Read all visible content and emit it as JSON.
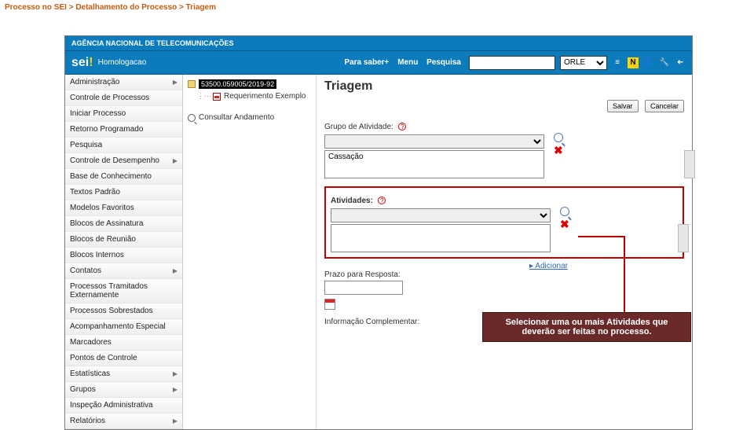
{
  "breadcrumb": "Processo no SEI > Detalhamento do Processo > Triagem",
  "banner": "AGÊNCIA NACIONAL DE TELECOMUNICAÇÕES",
  "logo": {
    "text": "sei",
    "accent": "!"
  },
  "env": "Homologacao",
  "header": {
    "parasaber": "Para saber+",
    "menu": "Menu",
    "pesquisa": "Pesquisa",
    "unit_selected": "ORLE",
    "icon_n": "N"
  },
  "sidebar": {
    "items": [
      {
        "label": "Administração",
        "arrow": true
      },
      {
        "label": "Controle de Processos",
        "arrow": false
      },
      {
        "label": "Iniciar Processo",
        "arrow": false
      },
      {
        "label": "Retorno Programado",
        "arrow": false
      },
      {
        "label": "Pesquisa",
        "arrow": false
      },
      {
        "label": "Controle de Desempenho",
        "arrow": true
      },
      {
        "label": "Base de Conhecimento",
        "arrow": false
      },
      {
        "label": "Textos Padrão",
        "arrow": false
      },
      {
        "label": "Modelos Favoritos",
        "arrow": false
      },
      {
        "label": "Blocos de Assinatura",
        "arrow": false
      },
      {
        "label": "Blocos de Reunião",
        "arrow": false
      },
      {
        "label": "Blocos Internos",
        "arrow": false
      },
      {
        "label": "Contatos",
        "arrow": true
      },
      {
        "label": "Processos Tramitados Externamente",
        "arrow": false
      },
      {
        "label": "Processos Sobrestados",
        "arrow": false
      },
      {
        "label": "Acompanhamento Especial",
        "arrow": false
      },
      {
        "label": "Marcadores",
        "arrow": false
      },
      {
        "label": "Pontos de Controle",
        "arrow": false
      },
      {
        "label": "Estatísticas",
        "arrow": true
      },
      {
        "label": "Grupos",
        "arrow": true
      },
      {
        "label": "Inspeção Administrativa",
        "arrow": false
      },
      {
        "label": "Relatórios",
        "arrow": true
      }
    ]
  },
  "tree": {
    "proc_number": "53500.059005/2019-92",
    "doc1": "Requerimento Exemplo",
    "consultar": "Consultar Andamento"
  },
  "main": {
    "title": "Triagem",
    "btn_salvar": "Salvar",
    "btn_cancelar": "Cancelar",
    "grupo_label": "Grupo de Atividade:",
    "grupo_value": "Cassação",
    "ativ_label": "Atividades:",
    "adicionar": "Adicionar",
    "prazo_label": "Prazo para Resposta:",
    "info_label": "Informação Complementar:"
  },
  "callout": "Selecionar uma ou mais Atividades que deverão ser feitas no processo."
}
